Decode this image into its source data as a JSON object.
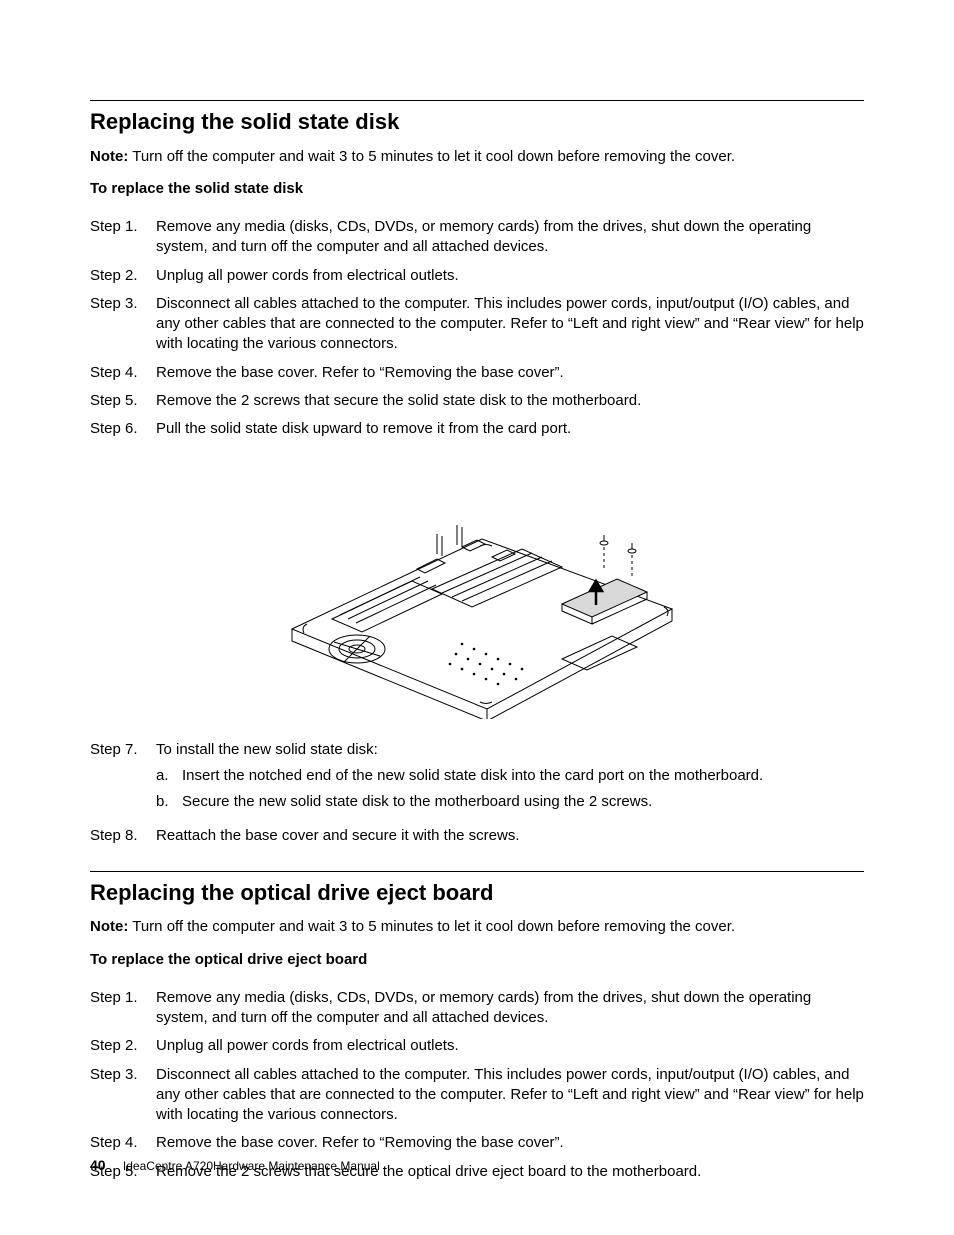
{
  "section1": {
    "heading": "Replacing the solid state disk",
    "noteLabel": "Note:",
    "noteText": "Turn off the computer and wait 3 to 5 minutes to let it cool down before removing the cover.",
    "subheading": "To replace the solid state disk",
    "steps": [
      {
        "label": "Step 1.",
        "text": "Remove any media (disks, CDs, DVDs, or memory cards) from the drives, shut down the operating system, and turn off the computer and all attached devices."
      },
      {
        "label": "Step 2.",
        "text": "Unplug all power cords from electrical outlets."
      },
      {
        "label": "Step 3.",
        "text": "Disconnect all cables attached to the computer. This includes power cords, input/output (I/O) cables, and any other cables that are connected to the computer. Refer to “Left and right view” and “Rear view” for help with locating the various connectors."
      },
      {
        "label": "Step 4.",
        "text": "Remove the base cover. Refer to “Removing the base cover”."
      },
      {
        "label": "Step 5.",
        "text": "Remove the 2 screws that secure the solid state disk to the motherboard."
      },
      {
        "label": "Step 6.",
        "text": "Pull the solid state disk upward to remove it from the card port."
      }
    ],
    "step7": {
      "label": "Step 7.",
      "text": "To install the new solid state disk:",
      "sub": [
        {
          "label": "a.",
          "text": "Insert the notched end of the new solid state disk into the card port on the motherboard."
        },
        {
          "label": "b.",
          "text": "Secure the new solid state disk to the motherboard using the 2 screws."
        }
      ]
    },
    "step8": {
      "label": "Step 8.",
      "text": "Reattach the base cover and secure it with the screws."
    }
  },
  "section2": {
    "heading": "Replacing the optical drive eject board",
    "noteLabel": "Note:",
    "noteText": "Turn off the computer and wait 3 to 5 minutes to let it cool down before removing the cover.",
    "subheading": "To replace the optical drive eject board",
    "steps": [
      {
        "label": "Step 1.",
        "text": "Remove any media (disks, CDs, DVDs, or memory cards) from the drives, shut down the operating system, and turn off the computer and all attached devices."
      },
      {
        "label": "Step 2.",
        "text": "Unplug all power cords from electrical outlets."
      },
      {
        "label": "Step 3.",
        "text": "Disconnect all cables attached to the computer. This includes power cords, input/output (I/O) cables, and any other cables that are connected to the computer. Refer to “Left and right view” and “Rear view” for help with locating the various connectors."
      },
      {
        "label": "Step 4.",
        "text": "Remove the base cover. Refer to “Removing the base cover”."
      },
      {
        "label": "Step 5.",
        "text": "Remove the 2 screws that secure the optical drive eject board to the motherboard."
      }
    ]
  },
  "footer": {
    "pageNum": "40",
    "docTitle": "IdeaCentre A720Hardware Maintenance Manual"
  }
}
